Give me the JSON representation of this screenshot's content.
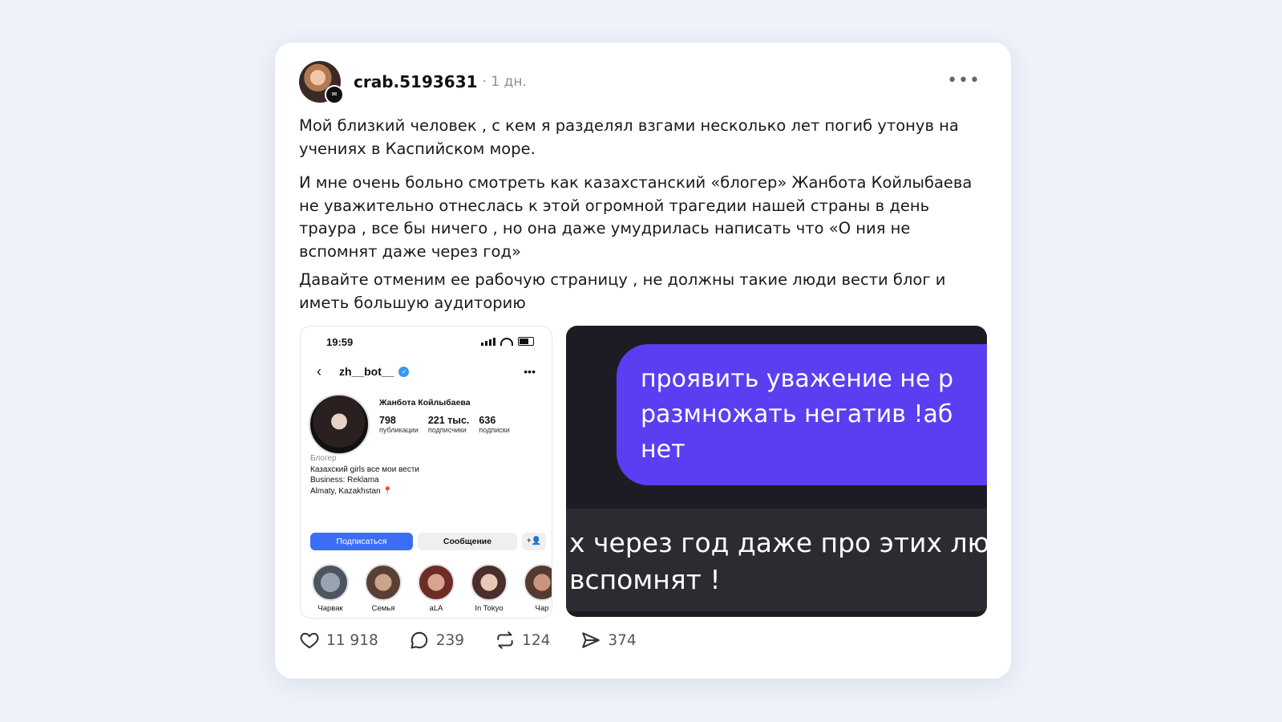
{
  "post": {
    "username": "crab.5193631",
    "time": "· 1 дн.",
    "more": "•••",
    "paragraphs": [
      "Мой близкий человек , с кем я разделял взгами несколько лет погиб утонув на учениях в Каспийском море.",
      "И мне очень больно смотреть как казахстанский «блогер» Жанбота Койлыбаева не уважительно отнеслась к этой огромной трагедии нашей страны в день траура , все бы ничего , но она даже умудрилась написать что «О ния не вспомнят даже через год»",
      "Давайте отменим ее рабочую страницу , не должны такие люди вести блог и иметь большую аудиторию"
    ]
  },
  "screenshot_profile": {
    "time": "19:59",
    "handle": "zh__bot__",
    "name": "Жанбота Койлыбаева",
    "stats": [
      {
        "num": "798",
        "label": "публикации"
      },
      {
        "num": "221 тыс.",
        "label": "подписчики"
      },
      {
        "num": "636",
        "label": "подписки"
      }
    ],
    "bio": {
      "category": "Блогер",
      "line1": "Казахский girls все мои вести",
      "line2": "Business: Reklama",
      "line3": "Almaty, Kazakhstan 📍"
    },
    "follow_label": "Подписаться",
    "message_label": "Сообщение",
    "add_label": "+👤",
    "highlights": [
      "Чарвак",
      "Семья",
      "aLA",
      "In Tokyo",
      "Чар"
    ]
  },
  "screenshot_video": {
    "bubble_text": "проявить уважение не р\nразмножать негатив !аб\nнет",
    "caption_text": "х через год даже про этих люд\nвспомнят !"
  },
  "actions": {
    "likes": "11 918",
    "comments": "239",
    "reposts": "124",
    "shares": "374"
  },
  "colors": {
    "page_bg": "#eef2f9",
    "follow_button": "#3b6ef5",
    "bubble": "#5a3ff2"
  }
}
